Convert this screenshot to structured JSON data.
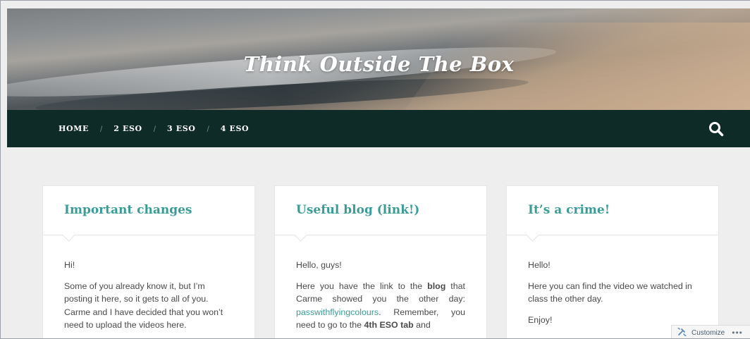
{
  "site": {
    "title": "Think Outside The Box"
  },
  "nav": {
    "items": [
      {
        "label": "HOME"
      },
      {
        "label": "2 ESO"
      },
      {
        "label": "3 ESO"
      },
      {
        "label": "4 ESO"
      }
    ],
    "separator": "/",
    "search_icon": "search-icon"
  },
  "posts": [
    {
      "title": "Important changes",
      "p1": "Hi!",
      "p2": "Some of you already know it, but I’m posting it here, so it gets to all of you. Carme and I have decided that you won’t need to upload the videos here."
    },
    {
      "title": "Useful blog (link!)",
      "p1": "Hello, guys!",
      "p2_a": "Here you have the link to the ",
      "p2_bold1": "blog",
      "p2_b": " that Carme showed you the other day: ",
      "p2_link": "passwithflyingcolours",
      "p2_c": ". Remember, you need to go to the ",
      "p2_bold2": "4th ESO tab",
      "p2_d": " and"
    },
    {
      "title": "It’s a crime!",
      "p1": "Hello!",
      "p2": "Here you can find the video we watched in class the other day.",
      "p3": "Enjoy!"
    }
  ],
  "customize": {
    "label": "Customize",
    "more": "•••"
  },
  "colors": {
    "nav_bg": "#0f2b27",
    "accent": "#3a9c97",
    "page_bg": "#eeeeef"
  }
}
